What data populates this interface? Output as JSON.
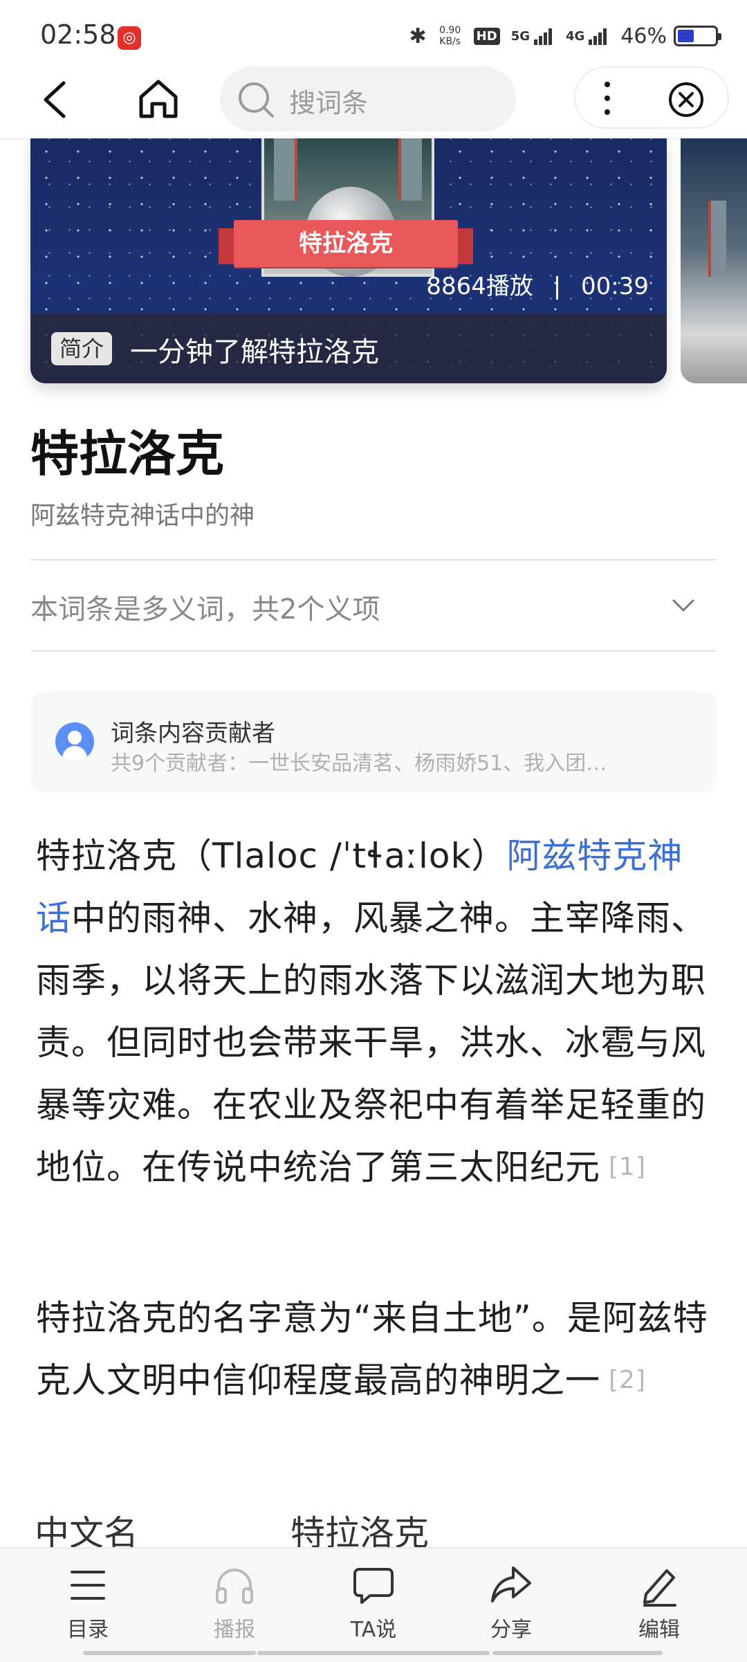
{
  "status_bar": {
    "time": "02:58",
    "net_speed_value": "0.90",
    "net_speed_unit": "KB/s",
    "hd_badge": "HD",
    "signal_1": "5G",
    "signal_2": "4G",
    "battery": "46%",
    "battery_level": 0.46
  },
  "nav": {
    "search_placeholder": "搜词条"
  },
  "video": {
    "banner_text": "特拉洛克",
    "plays": "8864播放",
    "separator": "|",
    "duration": "00:39",
    "tag": "简介",
    "title": "一分钟了解特拉洛克"
  },
  "entry": {
    "title": "特拉洛克",
    "subtitle": "阿兹特克神话中的神",
    "polysemy": "本词条是多义词，共2个义项"
  },
  "contributors": {
    "title": "词条内容贡献者",
    "list": "共9个贡献者：一世长安品清茗、杨雨娇51、我入团…"
  },
  "body": {
    "p1_a": "特拉洛克（Tlaloc /ˈtɬaːlok）",
    "p1_link": "阿兹特克神话",
    "p1_b": "中的雨神、水神，风暴之神。主宰降雨、雨季，以将天上的雨水落下以滋润大地为职责。但同时也会带来干旱，洪水、冰雹与风暴等灾难。在农业及祭祀中有着举足轻重的地位。在传说中统治了第三太阳纪元",
    "p1_ref": "[1]",
    "p2": "特拉洛克的名字意为“来自土地”。是阿兹特克人文明中信仰程度最高的神明之一",
    "p2_ref": "[2]"
  },
  "info": {
    "label": "中文名",
    "value": "特拉洛克"
  },
  "bottom_bar": {
    "toc": "目录",
    "broadcast": "播报",
    "ta_say": "TA说",
    "share": "分享",
    "edit": "编辑"
  }
}
